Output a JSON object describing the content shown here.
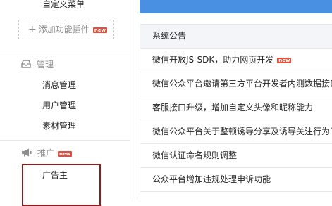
{
  "sidebar": {
    "custom_menu": "自定义菜单",
    "add_plugin": {
      "plus": "+",
      "label": "添加功能插件",
      "badge": "new"
    },
    "groups": [
      {
        "icon": "inbox-icon",
        "title": "管理",
        "items": [
          "消息管理",
          "用户管理",
          "素材管理"
        ]
      },
      {
        "icon": "megaphone-icon",
        "title": "推广",
        "badge": "new",
        "items": [
          "广告主"
        ]
      }
    ]
  },
  "main": {
    "announcement": {
      "title": "系统公告",
      "items": [
        {
          "text": "微信开放JS-SDK，助力网页开发",
          "badge": "new"
        },
        {
          "text": "微信公众平台邀请第三方平台开发者内测数据接口"
        },
        {
          "text": "客服接口升级，增加自定义头像和昵称能力"
        },
        {
          "text": "微信公众平台关于整顿诱导分享及诱导关注行为的"
        },
        {
          "text": "微信认证命名规则调整"
        },
        {
          "text": "公众平台增加违规处理申诉功能"
        }
      ]
    }
  },
  "colors": {
    "accent": "#4a90e2",
    "badge": "#e64d3b",
    "highlight_border": "#8b1e1e"
  }
}
